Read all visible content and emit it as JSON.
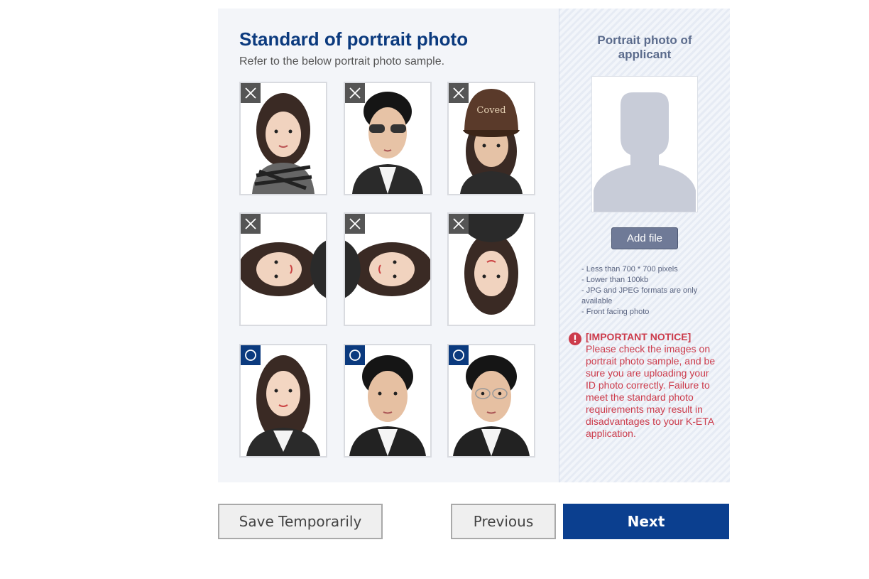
{
  "portrait_standard": {
    "title": "Standard of portrait photo",
    "subtitle": "Refer to the below portrait photo sample.",
    "samples": [
      {
        "status": "incorrect",
        "icon": "x-mark-icon",
        "description": "wearing scarf"
      },
      {
        "status": "incorrect",
        "icon": "x-mark-icon",
        "description": "wearing sunglasses"
      },
      {
        "status": "incorrect",
        "icon": "x-mark-icon",
        "description": "wearing cap"
      },
      {
        "status": "incorrect",
        "icon": "x-mark-icon",
        "description": "rotated left"
      },
      {
        "status": "incorrect",
        "icon": "x-mark-icon",
        "description": "rotated right"
      },
      {
        "status": "incorrect",
        "icon": "x-mark-icon",
        "description": "upside down"
      },
      {
        "status": "correct",
        "icon": "circle-mark-icon",
        "description": "correct woman"
      },
      {
        "status": "correct",
        "icon": "circle-mark-icon",
        "description": "correct man"
      },
      {
        "status": "correct",
        "icon": "circle-mark-icon",
        "description": "correct man with glasses"
      }
    ]
  },
  "applicant_photo": {
    "title": "Portrait photo of applicant",
    "placeholder_icon": "person-silhouette-icon",
    "add_file_label": "Add file",
    "requirements": [
      "- Less than 700 * 700 pixels",
      "- Lower than 100kb",
      "- JPG and JPEG formats are only available",
      "- Front facing photo"
    ],
    "notice": {
      "icon": "exclamation-icon",
      "title": "[IMPORTANT NOTICE]",
      "text": "Please check the images on portrait photo sample, and be sure you are uploading your ID photo correctly. Failure to meet the standard photo requirements may result in disadvantages to your K-ETA application."
    }
  },
  "colors": {
    "accent": "#0b3a7e",
    "notice": "#cc3b4b",
    "button_primary": "#0b3f8f"
  },
  "actions": {
    "save_label": "Save Temporarily",
    "previous_label": "Previous",
    "next_label": "Next"
  }
}
